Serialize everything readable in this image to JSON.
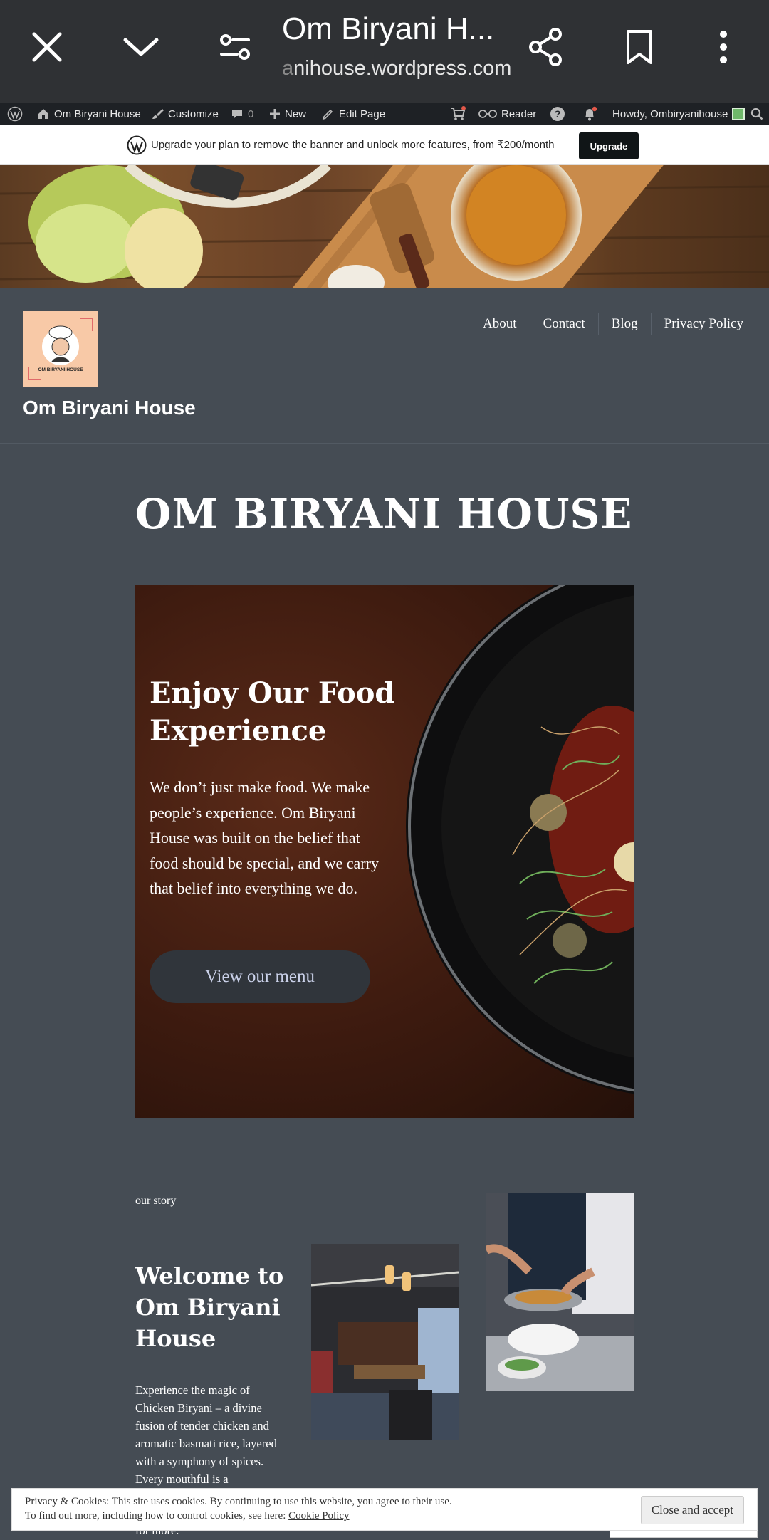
{
  "browser": {
    "title": "Om Biryani H...",
    "url_prefix": "a",
    "url_rest": "nihouse.wordpress.com"
  },
  "adminbar": {
    "site_label": "Om Biryani House",
    "customize_label": "Customize",
    "comments_count": "0",
    "new_label": "New",
    "edit_label": "Edit Page",
    "reader_label": "Reader",
    "howdy_label": "Howdy, Ombiryanihouse"
  },
  "banner": {
    "message": "Upgrade your plan to remove the banner and unlock more features, from ₹200/month",
    "button_label": "Upgrade"
  },
  "site": {
    "title": "Om Biryani House",
    "logo_text": "OM BIRYANI HOUSE",
    "nav": [
      "About",
      "Contact",
      "Blog",
      "Privacy Policy"
    ]
  },
  "page": {
    "title": "OM BIRYANI HOUSE",
    "cover": {
      "heading": "Enjoy Our Food Experience",
      "body": "We don’t just make food. We make people’s experience. Om Biryani House was built on the belief that food should be special, and we carry that belief into everything we do.",
      "button_label": "View our menu"
    },
    "story": {
      "kicker": "our story",
      "title": "Welcome to Om Biryani House",
      "body": "Experience the magic of Chicken Biryani – a divine fusion of tender chicken and aromatic basmati rice, layered with a symphony of spices. Every mouthful is a",
      "tail": "for more."
    }
  },
  "cookie": {
    "line1": "Privacy & Cookies: This site uses cookies. By continuing to use this website, you agree to their use.",
    "line2": "To find out more, including how to control cookies, see here:",
    "link": "Cookie Policy",
    "accept_label": "Close and accept"
  },
  "colors": {
    "page_bg": "#454c54",
    "chrome_bg": "#2f3134",
    "adminbar_bg": "#1e2125",
    "notification_dot": "#e2584a"
  },
  "icons": [
    "close-icon",
    "chevron-down-icon",
    "tune-icon",
    "share-icon",
    "bookmark-icon",
    "more-vert-icon",
    "wordpress-icon",
    "home-icon",
    "brush-icon",
    "comment-icon",
    "plus-icon",
    "pencil-icon",
    "cart-icon",
    "reader-icon",
    "help-icon",
    "bell-icon",
    "search-icon"
  ]
}
